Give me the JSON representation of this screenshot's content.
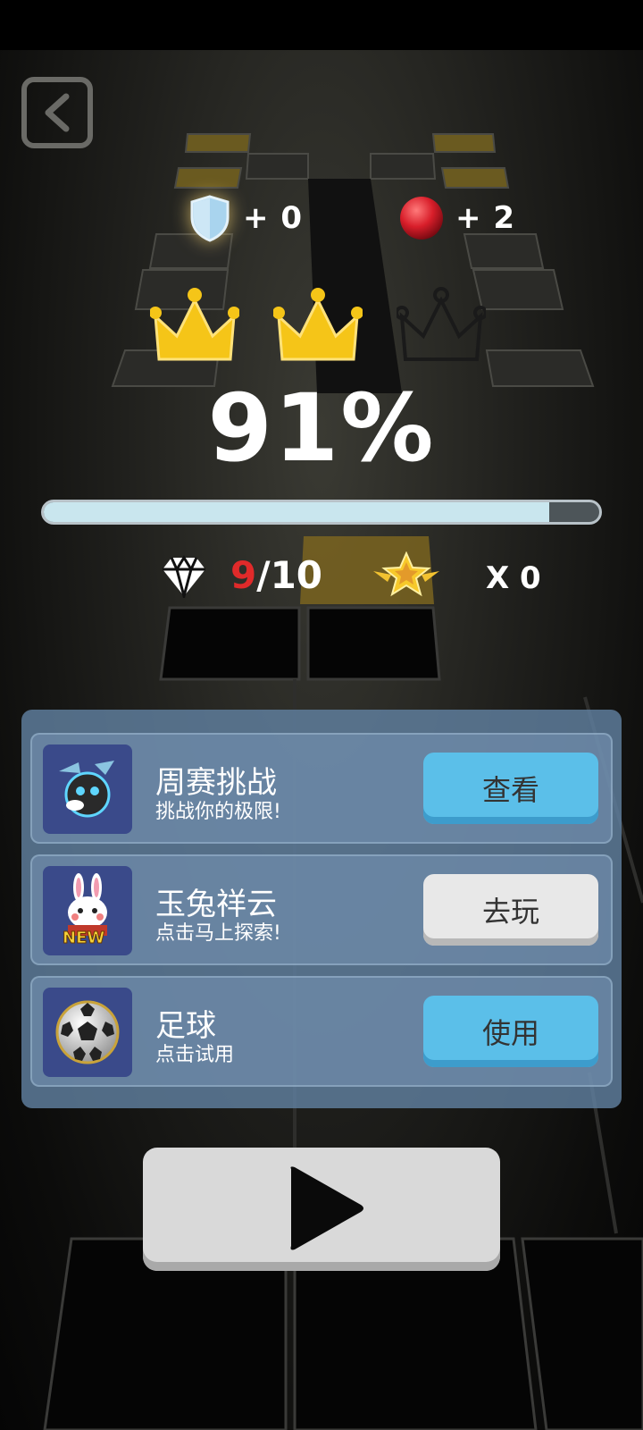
{
  "icons": {
    "back": "chevron-left-icon",
    "shield": "shield-icon",
    "ball": "red-ball-icon",
    "crown": "crown-icon",
    "diamond": "diamond-icon",
    "star": "winged-star-icon",
    "play": "play-icon"
  },
  "bonuses": {
    "shield": "+ 0",
    "ball": "+ 2"
  },
  "crowns": {
    "earned": 2,
    "total": 3
  },
  "result": {
    "percent_text": "91%",
    "progress": 0.91
  },
  "stats": {
    "gems_got": "9",
    "gems_total": "/10",
    "stars": "X 0"
  },
  "offers": [
    {
      "title": "周赛挑战",
      "subtitle": "挑战你的极限!",
      "button": "查看"
    },
    {
      "title": "玉兔祥云",
      "subtitle": "点击马上探索!",
      "button": "去玩",
      "badge": "NEW"
    },
    {
      "title": "足球",
      "subtitle": "点击试用",
      "button": "使用"
    }
  ],
  "colors": {
    "accent_blue": "#5bbfe9",
    "gem_red": "#e02a2a",
    "crown_gold": "#f5c518",
    "progress_fill": "#c9e6ee"
  }
}
